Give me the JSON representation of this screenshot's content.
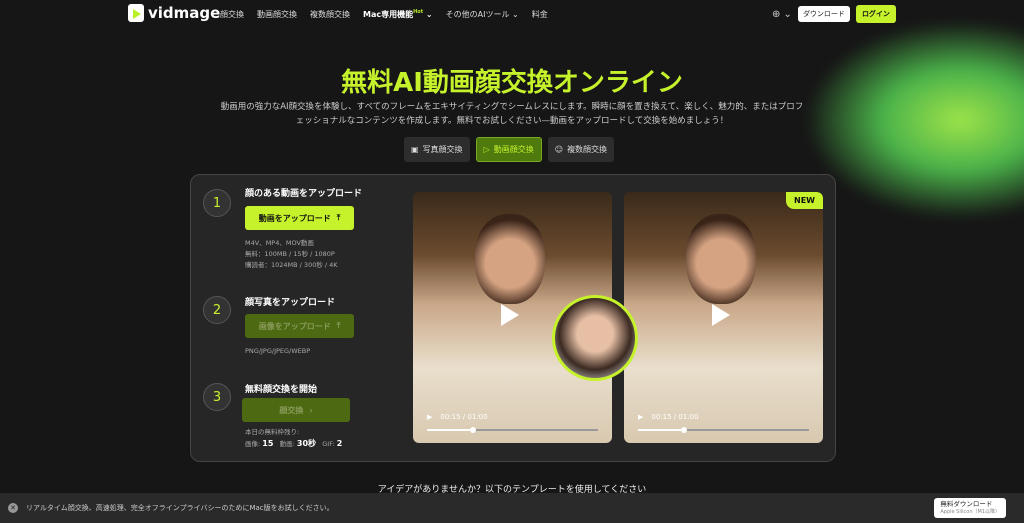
{
  "nav": {
    "logo": "vidmage",
    "items": [
      "顔交換",
      "動画顔交換",
      "複数顔交換"
    ],
    "mac": "Mac専用機能",
    "hot": "Hot",
    "other": "その他のAIツール",
    "price": "料金",
    "download": "ダウンロード",
    "login": "ログイン"
  },
  "hero": {
    "title": "無料AI動画顔交換オンライン",
    "desc": "動画用の強力なAI顔交換を体験し、すべてのフレームをエキサイティングでシームレスにします。瞬時に顔を置き換えて、楽しく、魅力的、またはプロフェッショナルなコンテンツを作成します。無料でお試しください—動画をアップロードして交換を始めましょう！"
  },
  "tabs": [
    "写真顔交換",
    "動画顔交換",
    "複数顔交換"
  ],
  "steps": [
    {
      "num": "1",
      "title": "顔のある動画をアップロード",
      "button": "動画をアップロード",
      "info": [
        "M4V、MP4、MOV動画",
        "無料：100MB / 15秒 / 1080P",
        "購読者：1024MB / 300秒 / 4K"
      ]
    },
    {
      "num": "2",
      "title": "顔写真をアップロード",
      "button": "画像をアップロード",
      "info": [
        "PNG/JPG/JPEG/WEBP"
      ]
    },
    {
      "num": "3",
      "title": "無料顔交換を開始",
      "button": "顔交換",
      "remaining_label": "本日の無料枠残り:",
      "image_label": "画像:",
      "image": "15",
      "video_label": "動画:",
      "video": "30秒",
      "gif_label": "GIF:",
      "gif": "2"
    }
  ],
  "videos": [
    {
      "time": "00:15 / 01:00",
      "progress": 0.25
    },
    {
      "time": "00:15 / 01:00",
      "progress": 0.25,
      "badge": "NEW"
    }
  ],
  "template_prompt": "アイデアがありませんか？以下のテンプレートを使用してください",
  "footer": {
    "text": "リアルタイム顔交換、高速処理、完全オフラインプライバシーのためにMac版をお試しください。",
    "download": "無料ダウンロード",
    "sub": "Apple Silicon（M1以降）"
  }
}
